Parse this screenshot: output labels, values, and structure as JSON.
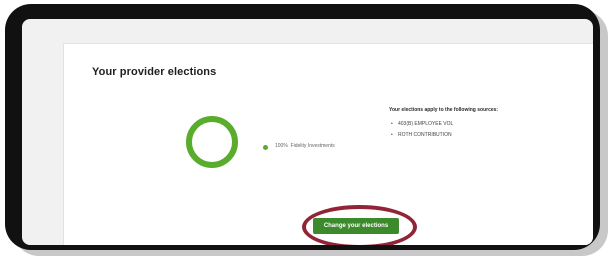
{
  "card": {
    "title": "Your provider elections"
  },
  "allocation": {
    "percent_label": "100%",
    "provider_name": "Fidelity Investments",
    "color": "#5aac2d",
    "share": 1.0
  },
  "sources": {
    "heading": "Your elections apply to the following sources:",
    "items": [
      {
        "bullet": "•",
        "label": "403(B) EMPLOYEE VOL"
      },
      {
        "bullet": "•",
        "label": "ROTH CONTRIBUTION"
      }
    ]
  },
  "actions": {
    "change_label": "Change your elections",
    "button_color": "#3c8a2c"
  },
  "annotation": {
    "oval_color": "#922437"
  }
}
